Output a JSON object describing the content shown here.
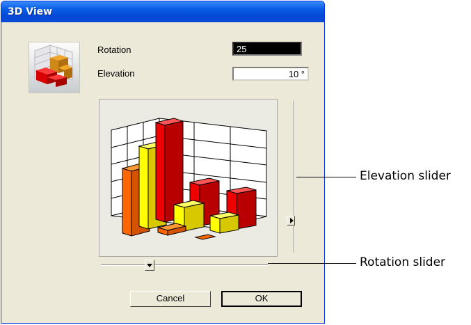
{
  "window": {
    "title": "3D View"
  },
  "controls": {
    "rotation_label": "Rotation",
    "rotation_value": "25",
    "elevation_label": "Elevation",
    "elevation_value": "10 °"
  },
  "sliders": {
    "elevation_level": 0.15,
    "rotation_level": 0.28
  },
  "buttons": {
    "cancel": "Cancel",
    "ok": "OK"
  },
  "callouts": {
    "elevation": "Elevation slider",
    "rotation": "Rotation slider"
  },
  "colors": {
    "titlebar": "#0a5fe7",
    "dialog_bg": "#ece9d8",
    "bar_red": "#ee0000",
    "bar_yellow": "#ffff00",
    "bar_orange": "#ff6600"
  },
  "icons": {
    "thumbnail": "3d-chart-preview-icon",
    "slider_arrow": "slider-thumb-arrow-icon"
  }
}
